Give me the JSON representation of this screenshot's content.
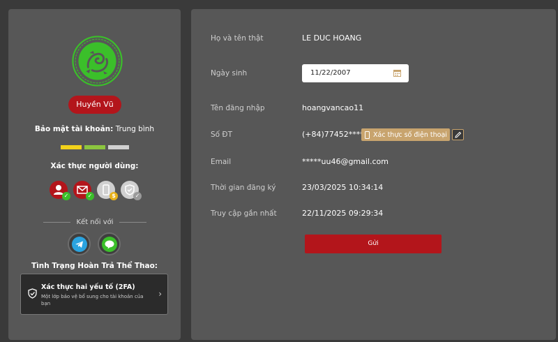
{
  "profile": {
    "name": "Huyền Vũ",
    "security_label": "Bảo mật tài khoản:",
    "security_level": "Trung bình",
    "security_bars": [
      "#f2d21b",
      "#8cc63f",
      "#d0d0d0"
    ],
    "auth_title": "Xác thực người dùng:",
    "auth_icons": [
      {
        "icon": "user-icon",
        "color": "#b3151b",
        "status": "verified"
      },
      {
        "icon": "mail-icon",
        "color": "#b3151b",
        "status": "verified"
      },
      {
        "icon": "phone-icon",
        "color": "#d0d0d0",
        "status": "pending"
      },
      {
        "icon": "shield-icon",
        "color": "#d0d0d0",
        "status": "unverified"
      }
    ],
    "connect_label": "Kết nối với",
    "social": [
      "telegram-icon",
      "line-icon"
    ],
    "sport_title": "Tình Trạng Hoàn Trả Thể Thao:",
    "twofa": {
      "title": "Xác thực hai yếu tố (2FA)",
      "desc": "Một lớp bảo vệ bổ sung cho tài khoản của bạn"
    }
  },
  "details": {
    "fullname_label": "Họ và tên thật",
    "fullname": "LE DUC HOANG",
    "dob_label": "Ngày sinh",
    "dob": "11/22/2007",
    "username_label": "Tên đăng nhập",
    "username": "hoangvancao11",
    "phone_label": "Số ĐT",
    "phone": "(+84)77452****",
    "verify_phone": "Xác thực số điện thoại",
    "email_label": "Email",
    "email": "*****uu46@gmail.com",
    "register_label": "Thời gian đăng ký",
    "register_time": "23/03/2025 10:34:14",
    "last_access_label": "Truy cập gần nhất",
    "last_access": "22/11/2025 09:29:34",
    "submit": "Gửi"
  },
  "colors": {
    "accent": "#b3151b",
    "gold": "#c8a46e",
    "logo_green": "#3bbf2a"
  }
}
